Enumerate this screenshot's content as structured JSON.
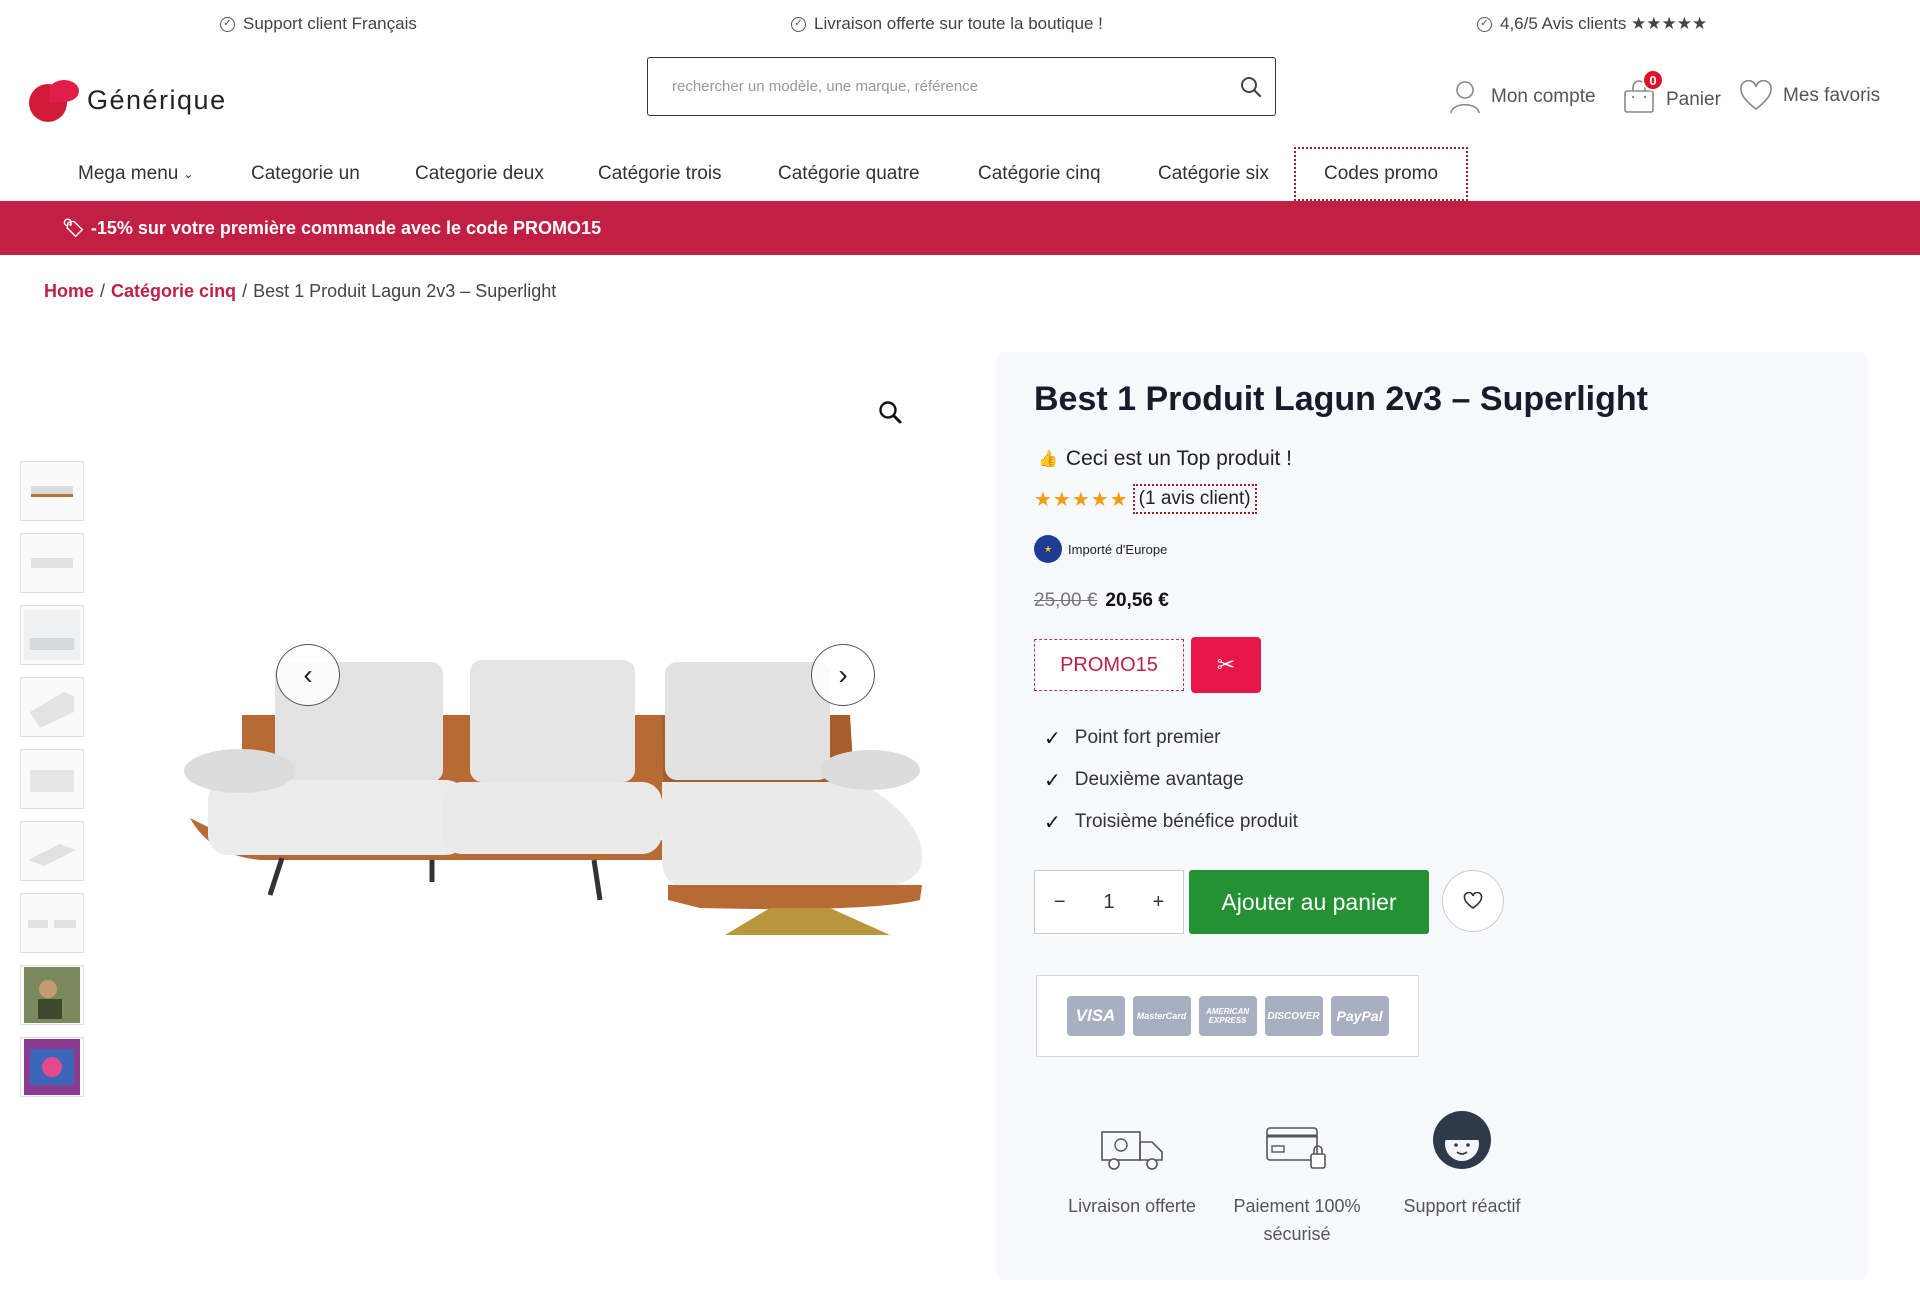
{
  "topbar": {
    "support": "Support client Français",
    "delivery": "Livraison offerte sur toute la boutique !",
    "reviews": "4,6/5 Avis clients ★★★★★"
  },
  "header": {
    "logo_text": "Générique",
    "search_placeholder": "rechercher un modèle, une marque, référence",
    "account_label": "Mon compte",
    "cart_label": "Panier",
    "cart_count": "0",
    "favorites_label": "Mes favoris"
  },
  "nav": {
    "items": [
      "Mega menu",
      "Categorie un",
      "Categorie deux",
      "Catégorie trois",
      "Catégorie quatre",
      "Catégorie cinq",
      "Catégorie six",
      "Codes promo"
    ]
  },
  "banner": {
    "text": "-15% sur votre première commande avec le code PROMO15"
  },
  "breadcrumb": {
    "home": "Home",
    "separator": "/",
    "category": "Catégorie cinq",
    "current": "Best 1 Produit Lagun 2v3 – Superlight"
  },
  "product": {
    "title": "Best 1 Produit Lagun 2v3 – Superlight",
    "top_label": "Ceci est un Top produit !",
    "stars": "★★★★★",
    "rating": 5,
    "reviews_text": "(1 avis client)",
    "origin": "Importé d'Europe",
    "old_price": "25,00 €",
    "new_price": "20,56 €",
    "coupon_code": "PROMO15",
    "features": [
      "Point fort premier",
      "Deuxième avantage",
      "Troisième bénéfice produit"
    ],
    "quantity": "1",
    "qty_minus": "−",
    "qty_plus": "+",
    "add_to_cart": "Ajouter au panier"
  },
  "payments": [
    "VISA",
    "MasterCard",
    "AMERICAN EXPRESS",
    "DISCOVER",
    "PayPal"
  ],
  "assurances": {
    "delivery": "Livraison offerte",
    "payment": "Paiement 100% sécurisé",
    "support": "Support réactif"
  },
  "colors": {
    "brand": "#c21f45",
    "cta": "#239134",
    "coupon_button": "#e8174a"
  }
}
